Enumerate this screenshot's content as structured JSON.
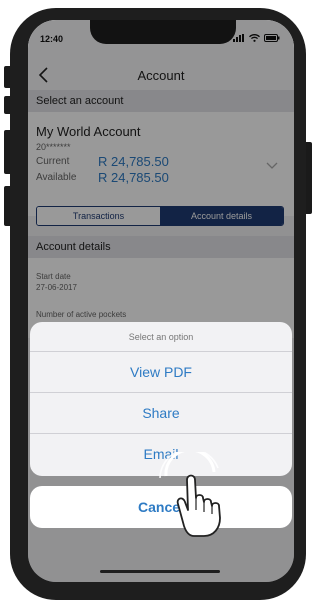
{
  "status_bar": {
    "time": "12:40",
    "icons": [
      "signal-icon",
      "wifi-icon",
      "battery-icon"
    ]
  },
  "nav": {
    "title": "Account",
    "back_icon": "chevron-left-icon"
  },
  "select_account": {
    "header": "Select an account",
    "account_name": "My World Account",
    "account_number": "20*******",
    "current_label": "Current",
    "current_value": "R 24,785.50",
    "available_label": "Available",
    "available_value": "R 24,785.50"
  },
  "tabs": {
    "transactions": "Transactions",
    "account_details": "Account details",
    "selected": "account_details"
  },
  "details": {
    "header": "Account details",
    "start_date_label": "Start date",
    "start_date_value": "27-06-2017",
    "pockets_label": "Number of active pockets"
  },
  "action_sheet": {
    "title": "Select an option",
    "options": [
      "View PDF",
      "Share",
      "Email"
    ],
    "cancel": "Cancel"
  },
  "colors": {
    "accent_blue": "#2e7bc4",
    "navy": "#1f3b73",
    "overlay": "rgba(0,0,0,0.40)"
  }
}
